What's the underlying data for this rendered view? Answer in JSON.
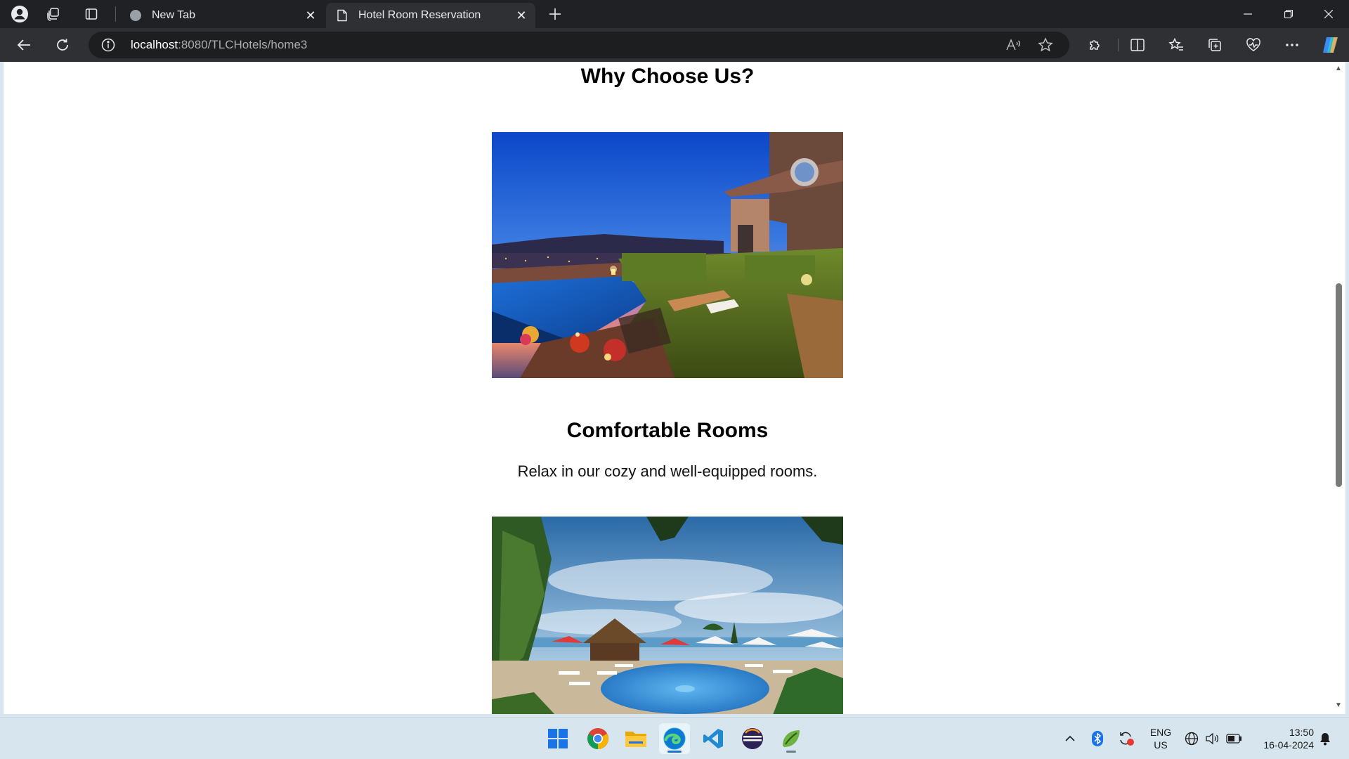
{
  "browser": {
    "tabs": [
      {
        "title": "New Tab",
        "active": false
      },
      {
        "title": "Hotel Room Reservation",
        "active": true
      }
    ],
    "address": {
      "host": "localhost",
      "path": ":8080/TLCHotels/home3"
    }
  },
  "page": {
    "heading": "Why Choose Us?",
    "feature": {
      "title": "Comfortable Rooms",
      "description": "Relax in our cozy and well-equipped rooms."
    }
  },
  "taskbar": {
    "language": {
      "line1": "ENG",
      "line2": "US"
    },
    "time": "13:50",
    "date": "16-04-2024"
  },
  "colors": {
    "titlebar": "#202124",
    "toolbar": "#2f3033",
    "taskbar": "#d7e6ee",
    "page": "#ffffff"
  }
}
